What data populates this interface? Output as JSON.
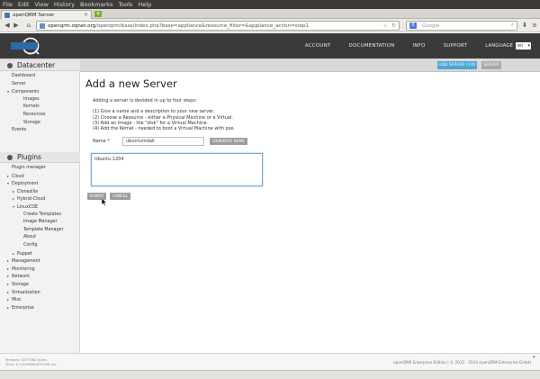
{
  "browser": {
    "menu": [
      "File",
      "Edit",
      "View",
      "History",
      "Bookmarks",
      "Tools",
      "Help"
    ],
    "tab_title": "openQRM Server",
    "url_host": "openqrm.oqnet.org",
    "url_path": "/openqrm/base/index.php?base=appliance&resource_filter=&appliance_action=step1",
    "url_prefix": "",
    "search_placeholder": "Google",
    "search_engine": "8"
  },
  "header": {
    "nav": [
      "ACCOUNT",
      "DOCUMENTATION",
      "INFO",
      "SUPPORT"
    ],
    "language_label": "LANGUAGE",
    "language_value": "en"
  },
  "strip": {
    "add_server_label": "ADD SERVER (1/4)",
    "server_label": "SERVER"
  },
  "sidebar": {
    "datacenter_title": "Datacenter",
    "datacenter_items": [
      {
        "label": "Dashboard",
        "level": 0,
        "arrow": ""
      },
      {
        "label": "Server",
        "level": 0,
        "arrow": ""
      },
      {
        "label": "Components",
        "level": 0,
        "arrow": "▾"
      },
      {
        "label": "Images",
        "level": 2,
        "arrow": ""
      },
      {
        "label": "Kernels",
        "level": 2,
        "arrow": ""
      },
      {
        "label": "Resources",
        "level": 2,
        "arrow": ""
      },
      {
        "label": "Storage",
        "level": 2,
        "arrow": ""
      },
      {
        "label": "Events",
        "level": 0,
        "arrow": ""
      }
    ],
    "plugins_title": "Plugins",
    "plugin_items": [
      {
        "label": "Plugin manager",
        "level": 0,
        "arrow": ""
      },
      {
        "label": "Cloud",
        "level": 0,
        "arrow": "▸"
      },
      {
        "label": "Deployment",
        "level": 0,
        "arrow": "▾"
      },
      {
        "label": "Clonezilla",
        "level": 1,
        "arrow": "▸"
      },
      {
        "label": "Hybrid-Cloud",
        "level": 1,
        "arrow": "▸"
      },
      {
        "label": "LinuxCOE",
        "level": 1,
        "arrow": "▾"
      },
      {
        "label": "Create Templates",
        "level": 2,
        "arrow": ""
      },
      {
        "label": "Image Manager",
        "level": 2,
        "arrow": ""
      },
      {
        "label": "Template Manager",
        "level": 2,
        "arrow": ""
      },
      {
        "label": "About",
        "level": 2,
        "arrow": ""
      },
      {
        "label": "Config",
        "level": 2,
        "arrow": ""
      },
      {
        "label": "Puppet",
        "level": 1,
        "arrow": "▸"
      },
      {
        "label": "Management",
        "level": 0,
        "arrow": "▸"
      },
      {
        "label": "Monitoring",
        "level": 0,
        "arrow": "▸"
      },
      {
        "label": "Network",
        "level": 0,
        "arrow": "▸"
      },
      {
        "label": "Storage",
        "level": 0,
        "arrow": "▸"
      },
      {
        "label": "Virtualization",
        "level": 0,
        "arrow": "▸"
      },
      {
        "label": "Misc",
        "level": 0,
        "arrow": "▸"
      },
      {
        "label": "Enterprise",
        "level": 0,
        "arrow": "▸"
      }
    ]
  },
  "main": {
    "title": "Add a new Server",
    "intro_lines": [
      "Adding a server is devided in up to four steps:",
      "",
      "(1) Give a name and a description to your new server.",
      "(2) Choose a Resource - either a Physical Machine or a Virtual.",
      "(3) Add an Image - the \"disk\" for a Virtual Machine.",
      "(4) Add the Kernel - needed to boot a Virtual Machine with pxe."
    ],
    "name_label": "Name *",
    "name_value": "ubuntumdall",
    "generate_label": "GENERATE NAME",
    "description_value": "Ubuntu 1204",
    "submit_label": "SUBMIT",
    "cancel_label": "CANCEL"
  },
  "footer": {
    "memory_line": "Memory: 4277080 bytes",
    "time_line": "Time: 0.11076860679199 sec",
    "copyright": "openQRM Enterprise Edition | © 2012 - 2014 openQRM Enterprise GmbH"
  }
}
